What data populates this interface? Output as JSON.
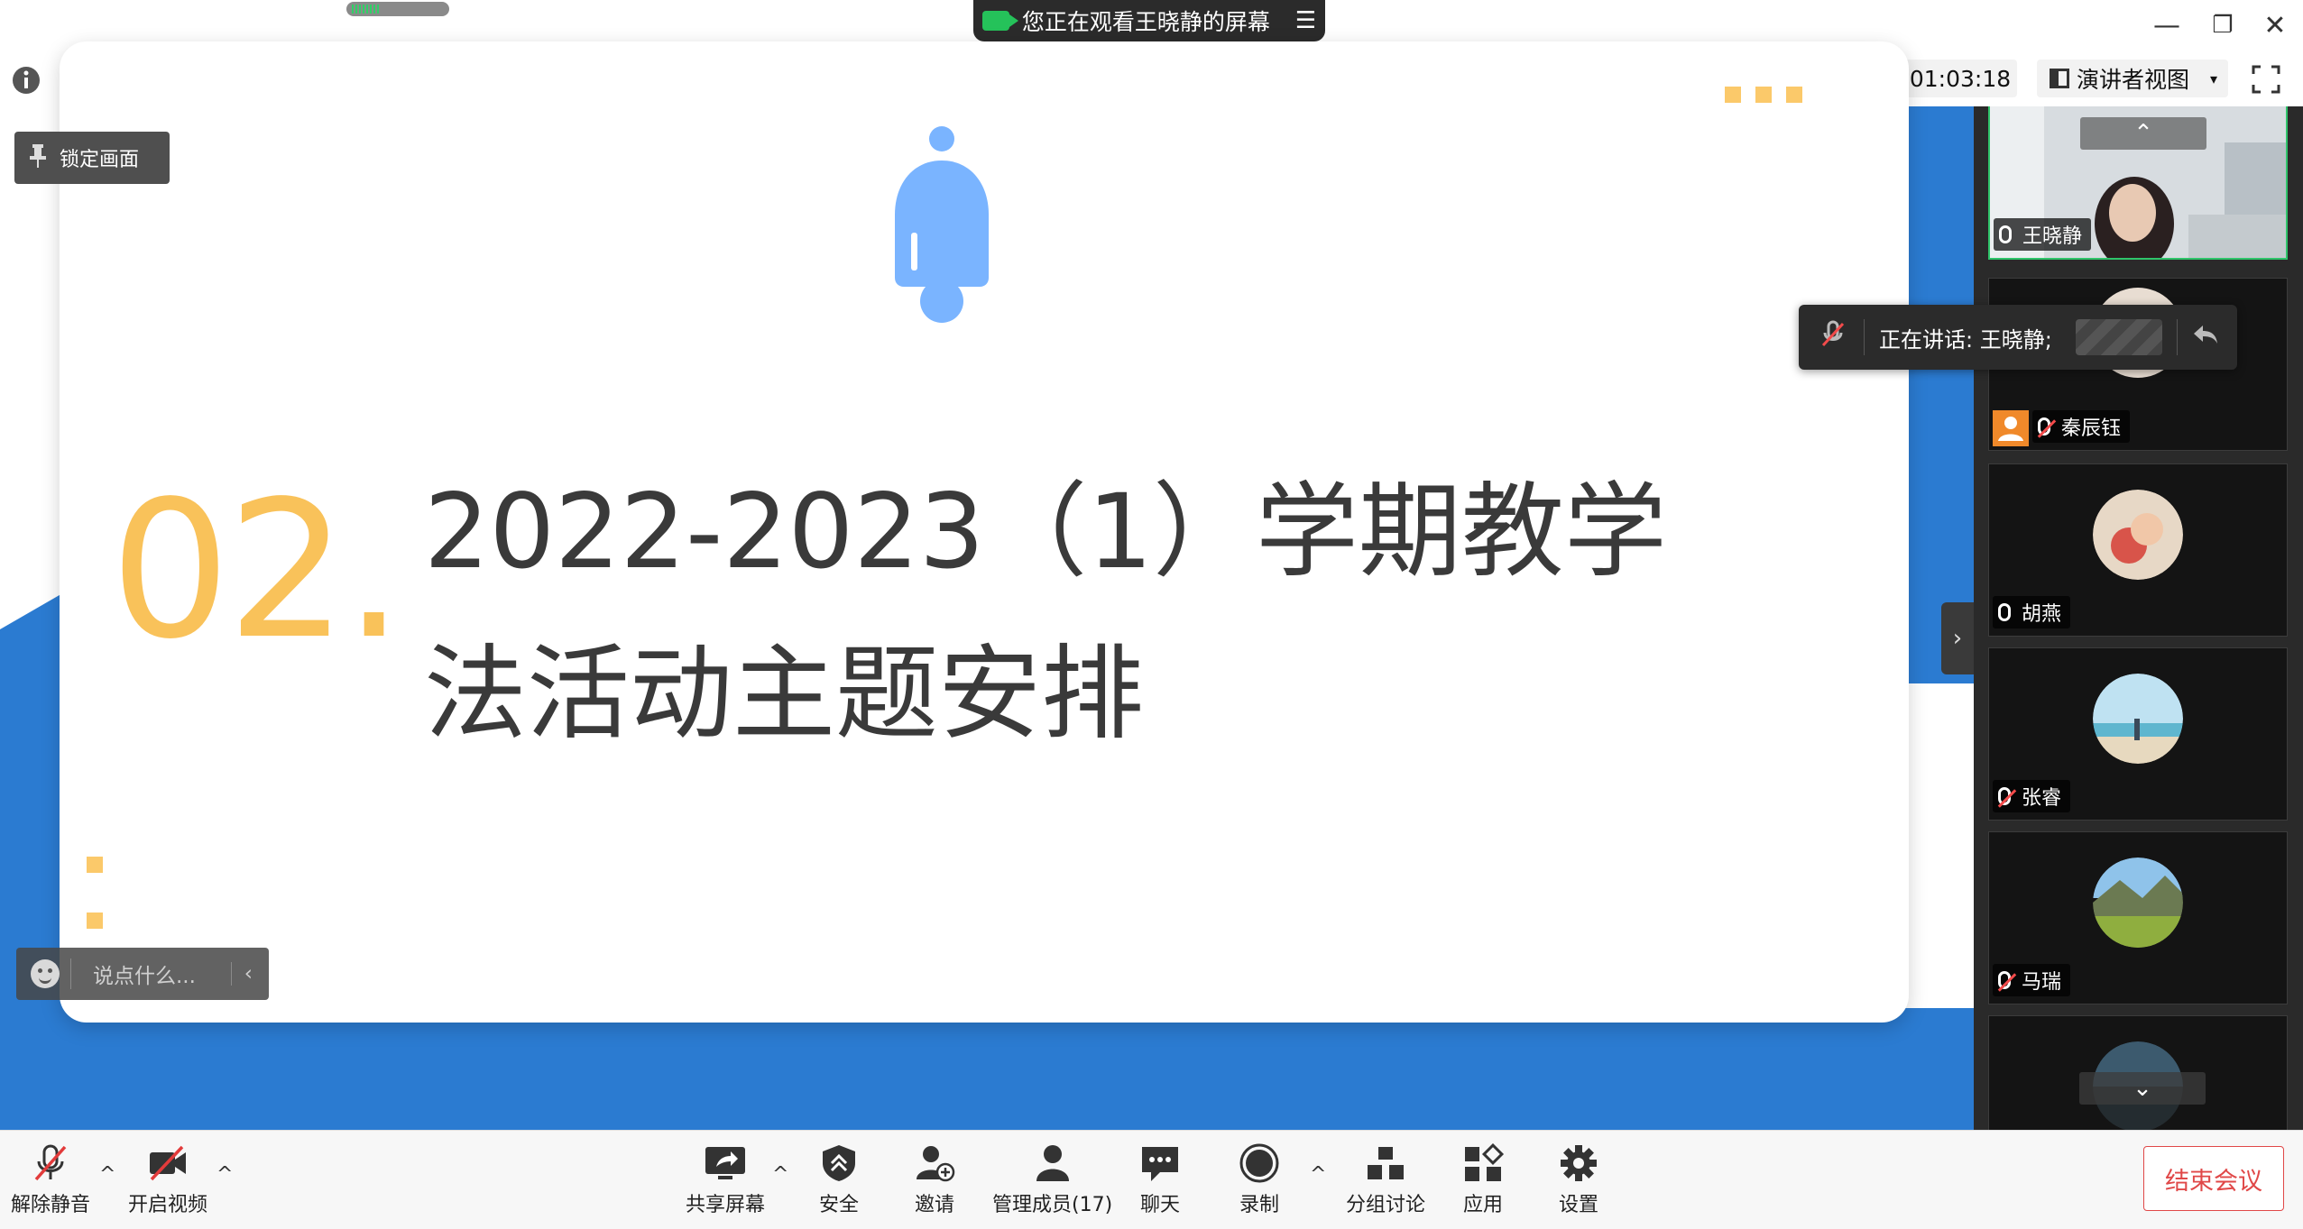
{
  "window": {
    "share_banner": "您正在观看王晓静的屏幕",
    "minimize": "—",
    "restore": "❐",
    "close": "✕"
  },
  "toolbar": {
    "timer": "01:03:18",
    "view_mode": "演讲者视图",
    "view_caret": "▾"
  },
  "stage": {
    "lock_button": "锁定画面",
    "slide_number": "02.",
    "slide_title_line1": "2022-2023（1）学期教学",
    "slide_title_line2": "法活动主题安排",
    "chat_placeholder": "说点什么...",
    "chat_arrow": "‹",
    "collapse_arrow": "›"
  },
  "panel": {
    "speaking_toast": "正在讲话: 王晓静;",
    "participants": [
      {
        "name": "王晓静",
        "muted": false
      },
      {
        "name": "秦辰钰",
        "muted": true
      },
      {
        "name": "胡燕",
        "muted": false
      },
      {
        "name": "张睿",
        "muted": true
      },
      {
        "name": "马瑞",
        "muted": true
      }
    ],
    "scroll_up": "⌃",
    "scroll_down": "⌄"
  },
  "controls": {
    "unmute": "解除静音",
    "start_video": "开启视频",
    "share_screen": "共享屏幕",
    "security": "安全",
    "invite": "邀请",
    "manage_members": "管理成员(17)",
    "chat": "聊天",
    "record": "录制",
    "breakout": "分组讨论",
    "apps": "应用",
    "settings": "设置",
    "end_meeting": "结束会议",
    "caret": "^"
  },
  "colors": {
    "accent_blue": "#2b7bd1",
    "slide_orange": "#f9c25a",
    "bell_blue": "#7ab4ff",
    "end_red": "#e04848"
  }
}
